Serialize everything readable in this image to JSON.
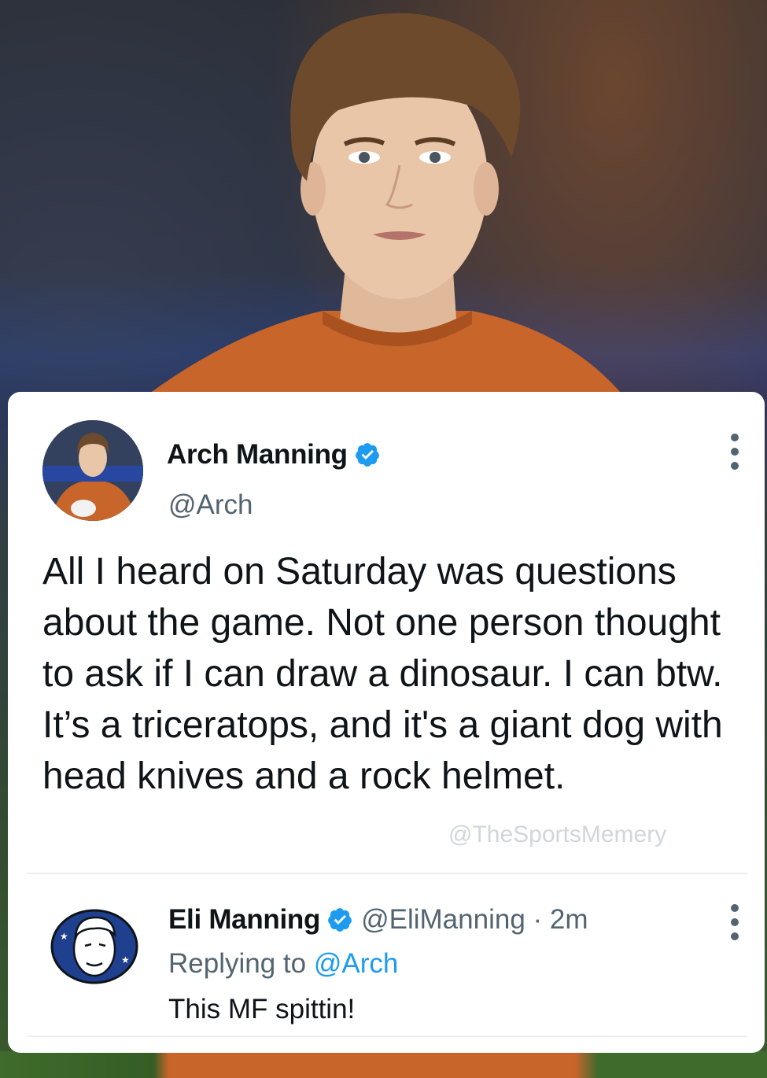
{
  "tweet": {
    "author_name": "Arch Manning",
    "author_handle": "@Arch",
    "text": "All I heard on Saturday was questions about the game. Not one person thought to ask if I can draw a dinosaur. I can btw. It’s a triceratops, and it's a giant dog with head knives and a rock helmet.",
    "verified": true
  },
  "watermark": "@TheSportsMemery",
  "reply": {
    "author_name": "Eli Manning",
    "author_handle": "@EliManning",
    "separator": " · ",
    "time": "2m",
    "replying_prefix": "Replying to ",
    "replying_to": "@Arch",
    "text": "This MF spittin!",
    "verified": true
  },
  "colors": {
    "verified_blue": "#1d9bf0",
    "text_primary": "#0f1419",
    "text_secondary": "#536471",
    "jersey_orange": "#c7652a"
  },
  "icons": {
    "verified": "verified-badge-icon",
    "more": "more-vertical-icon"
  }
}
